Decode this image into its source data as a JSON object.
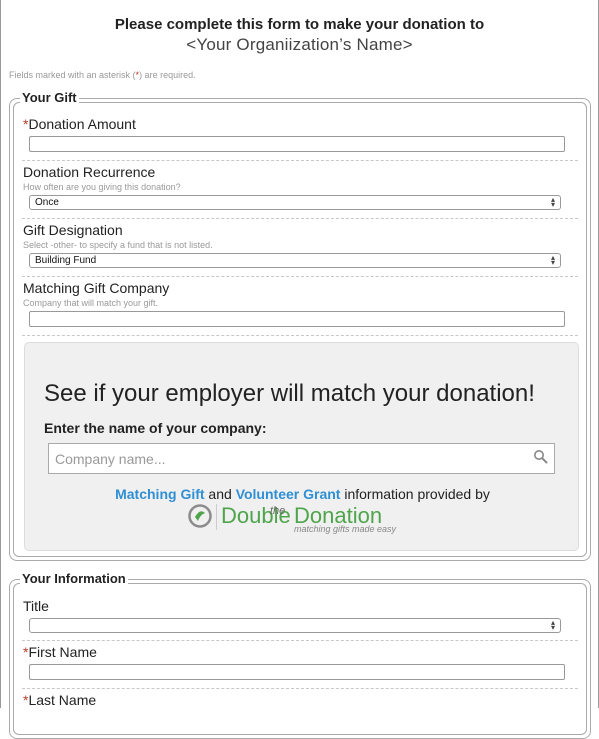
{
  "header": {
    "line1": "Please complete this form to make your donation to",
    "line2": "<Your Organiization’s Name>"
  },
  "required_note": {
    "prefix": "Fields marked with an asterisk (",
    "asterisk": "*",
    "suffix": ") are required."
  },
  "your_gift": {
    "title": "Your Gift",
    "donation_amount": {
      "asterisk": "*",
      "label": "Donation Amount",
      "value": ""
    },
    "recurrence": {
      "label": "Donation Recurrence",
      "hint": "How often are you giving this donation?",
      "value": "Once"
    },
    "designation": {
      "label": "Gift Designation",
      "hint": "Select -other- to specify a fund that is not listed.",
      "value": "Building Fund"
    },
    "matching_company": {
      "label": "Matching Gift Company",
      "hint": "Company that will match your gift.",
      "value": ""
    },
    "match_widget": {
      "headline": "See if your employer will match your donation!",
      "prompt": "Enter the name of your company:",
      "placeholder": "Company name...",
      "provided_link1": "Matching Gift",
      "provided_and": " and ",
      "provided_link2": "Volunteer Grant",
      "provided_suffix": " information provided by",
      "logo_word1": "Double",
      "logo_the": "the",
      "logo_word2": "Donation",
      "logo_tagline": "matching gifts made easy"
    }
  },
  "your_information": {
    "title": "Your Information",
    "title_field": {
      "label": "Title",
      "value": ""
    },
    "first_name": {
      "asterisk": "*",
      "label": "First Name",
      "value": ""
    },
    "last_name": {
      "asterisk": "*",
      "label": "Last Name",
      "value": ""
    }
  },
  "colors": {
    "required": "#c0392b",
    "link_blue": "#2e8fd4",
    "brand_green": "#4ea54b"
  }
}
